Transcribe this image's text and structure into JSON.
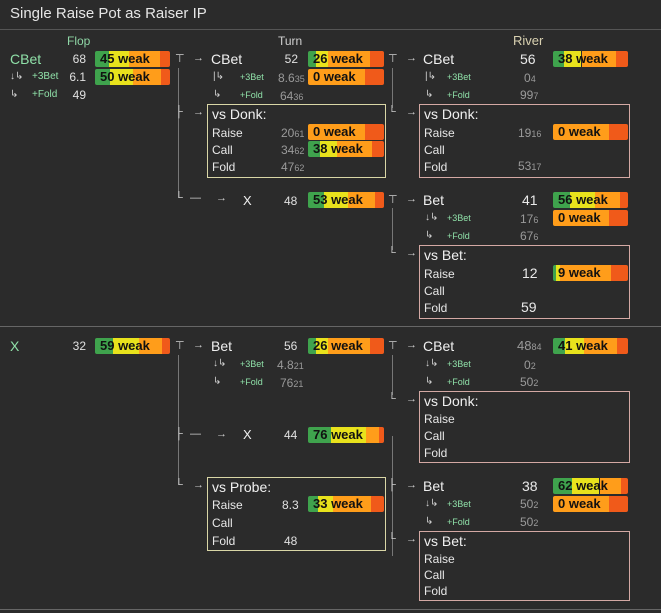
{
  "title": "Single Raise Pot as Raiser IP",
  "headers": {
    "flop": "Flop",
    "turn": "Turn",
    "river": "River"
  },
  "flop": {
    "cbet": {
      "label": "CBet",
      "val": "68",
      "bar": "45 weak"
    },
    "raise3": {
      "label": "+3Bet",
      "prefix": "↓↳",
      "val": "6.1",
      "bar": "50 weak"
    },
    "fold": {
      "label": "+Fold",
      "prefix": "↳",
      "val": "49"
    },
    "check": {
      "label": "X",
      "val": "32",
      "bar": "59 weak"
    }
  },
  "turn_a": {
    "cbet": {
      "label": "CBet",
      "val": "52",
      "bar": "26 weak"
    },
    "raise3": {
      "label": "+3Bet",
      "prefix": "|↳",
      "val": "8.6",
      "valsub": "35",
      "bar": "0 weak"
    },
    "fold": {
      "label": "+Fold",
      "prefix": "↳",
      "val": "64",
      "valsub": "36"
    },
    "donk": {
      "title": "vs Donk:",
      "raise": "Raise",
      "raise_val": "20",
      "raise_sub": "61",
      "raise_bar": "0 weak",
      "call": "Call",
      "call_val": "34",
      "call_sub": "62",
      "call_bar": "38 weak",
      "fold": "Fold",
      "fold_val": "47",
      "fold_sub": "62"
    },
    "check": {
      "label": "X",
      "val": "48",
      "bar": "53 weak"
    }
  },
  "river_a": {
    "cbet": {
      "label": "CBet",
      "val": "56",
      "bar": "38 weak"
    },
    "raise3": {
      "label": "+3Bet",
      "prefix": "|↳",
      "val": "0",
      "valsub": "4"
    },
    "fold": {
      "label": "+Fold",
      "prefix": "↳",
      "val": "99",
      "valsub": "7"
    },
    "donk": {
      "title": "vs Donk:",
      "raise": "Raise",
      "raise_val": "19",
      "raise_sub": "16",
      "raise_bar": "0 weak",
      "call": "Call",
      "fold": "Fold",
      "fold_val": "53",
      "fold_sub": "17"
    },
    "bet": {
      "label": "Bet",
      "val": "41",
      "bar": "56 weak"
    },
    "bet_raise3": {
      "label": "+3Bet",
      "prefix": "↓↳",
      "val": "17",
      "valsub": "6",
      "bar": "0 weak"
    },
    "bet_fold": {
      "label": "+Fold",
      "prefix": "↳",
      "val": "67",
      "valsub": "6"
    },
    "vsbet": {
      "title": "vs Bet:",
      "raise": "Raise",
      "raise_val": "12",
      "raise_bar": "9 weak",
      "call": "Call",
      "fold": "Fold",
      "fold_val": "59"
    }
  },
  "turn_b": {
    "bet": {
      "label": "Bet",
      "val": "56",
      "bar": "26 weak"
    },
    "raise3": {
      "label": "+3Bet",
      "prefix": "↓↳",
      "val": "4.8",
      "valsub": "21"
    },
    "fold": {
      "label": "+Fold",
      "prefix": "↳",
      "val": "76",
      "valsub": "21"
    },
    "check": {
      "label": "X",
      "val": "44",
      "bar": "76 weak"
    },
    "probe": {
      "title": "vs Probe:",
      "raise": "Raise",
      "raise_val": "8.3",
      "raise_bar": "33 weak",
      "call": "Call",
      "fold": "Fold",
      "fold_val": "48"
    }
  },
  "river_b": {
    "cbet": {
      "label": "CBet",
      "val": "48",
      "valsub": "84",
      "bar": "41 weak"
    },
    "raise3": {
      "label": "+3Bet",
      "prefix": "↓↳",
      "val": "0",
      "valsub": "2"
    },
    "fold": {
      "label": "+Fold",
      "prefix": "↳",
      "val": "50",
      "valsub": "2"
    },
    "donk": {
      "title": "vs Donk:",
      "raise": "Raise",
      "call": "Call",
      "fold": "Fold"
    },
    "bet": {
      "label": "Bet",
      "val": "38",
      "bar": "62 weak"
    },
    "bet_raise3": {
      "label": "+3Bet",
      "prefix": "↓↳",
      "val": "50",
      "valsub": "2",
      "bar": "0 weak"
    },
    "bet_fold": {
      "label": "+Fold",
      "prefix": "↳",
      "val": "50",
      "valsub": "2"
    },
    "vsbet": {
      "title": "vs Bet:",
      "raise": "Raise",
      "call": "Call",
      "fold": "Fold"
    }
  },
  "arrows": {
    "right": "→",
    "tee": "⊤",
    "branch": "├",
    "corner": "└",
    "dash": "—",
    "pipe": "|"
  }
}
